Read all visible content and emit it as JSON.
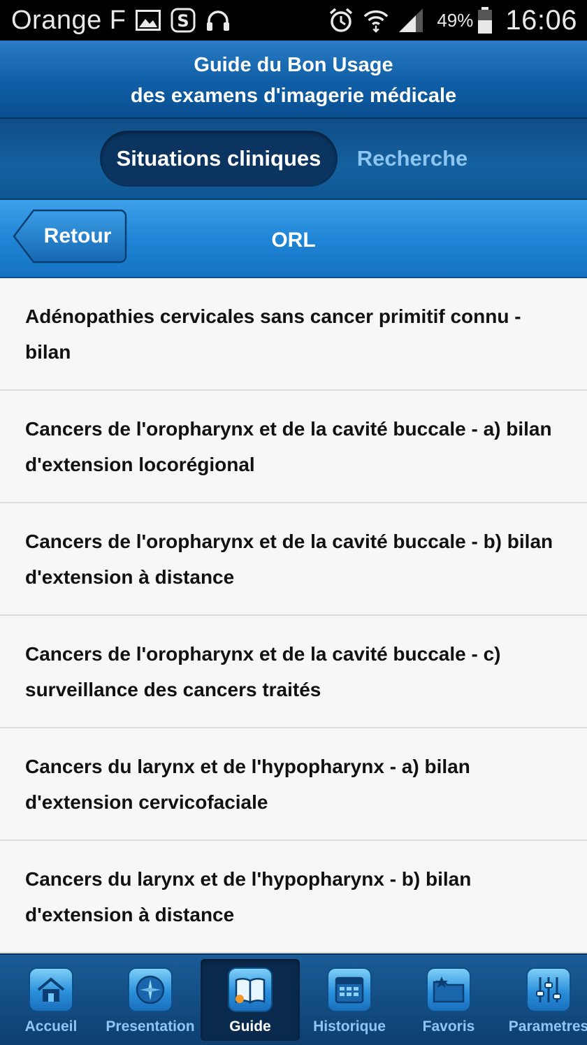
{
  "status_bar": {
    "carrier": "Orange F",
    "icons": [
      "image-icon",
      "skype-icon",
      "headphones-icon",
      "alarm-icon",
      "wifi-icon",
      "signal-icon",
      "battery-icon"
    ],
    "battery": "49%",
    "time": "16:06"
  },
  "header": {
    "title_line1": "Guide du Bon Usage",
    "title_line2": "des examens d'imagerie médicale"
  },
  "segments": {
    "active": "Situations cliniques",
    "inactive": "Recherche"
  },
  "nav": {
    "back_label": "Retour",
    "title": "ORL"
  },
  "list": {
    "items": [
      {
        "line1": "Adénopathies cervicales sans cancer primitif connu -",
        "line2": "bilan"
      },
      {
        "line1": "Cancers de l'oropharynx et de la cavité buccale - a) bilan",
        "line2": "d'extension locorégional"
      },
      {
        "line1": "Cancers de l'oropharynx et de la cavité buccale - b) bilan",
        "line2": "d'extension à distance"
      },
      {
        "line1": "Cancers de l'oropharynx et de la cavité buccale - c)",
        "line2": "surveillance des cancers traités"
      },
      {
        "line1": "Cancers du larynx et de l'hypopharynx - a) bilan",
        "line2": "d'extension cervicofaciale"
      },
      {
        "line1": "Cancers du larynx et de l'hypopharynx - b) bilan",
        "line2": "d'extension à distance"
      }
    ]
  },
  "tabbar": {
    "tabs": [
      {
        "label": "Accueil",
        "icon": "home-icon"
      },
      {
        "label": "Presentation",
        "icon": "compass-icon"
      },
      {
        "label": "Guide",
        "icon": "book-icon"
      },
      {
        "label": "Historique",
        "icon": "calendar-icon"
      },
      {
        "label": "Favoris",
        "icon": "folder-star-icon"
      },
      {
        "label": "Parametres",
        "icon": "sliders-icon"
      }
    ],
    "active_index": 2
  },
  "colors": {
    "header_blue": "#0f5ea6",
    "nav_blue": "#1f85d6",
    "segment_active_bg": "#0b3461",
    "segment_inactive_text": "#8cc4f2",
    "list_bg": "#f7f7f7",
    "list_divider": "#dcdcdc"
  }
}
